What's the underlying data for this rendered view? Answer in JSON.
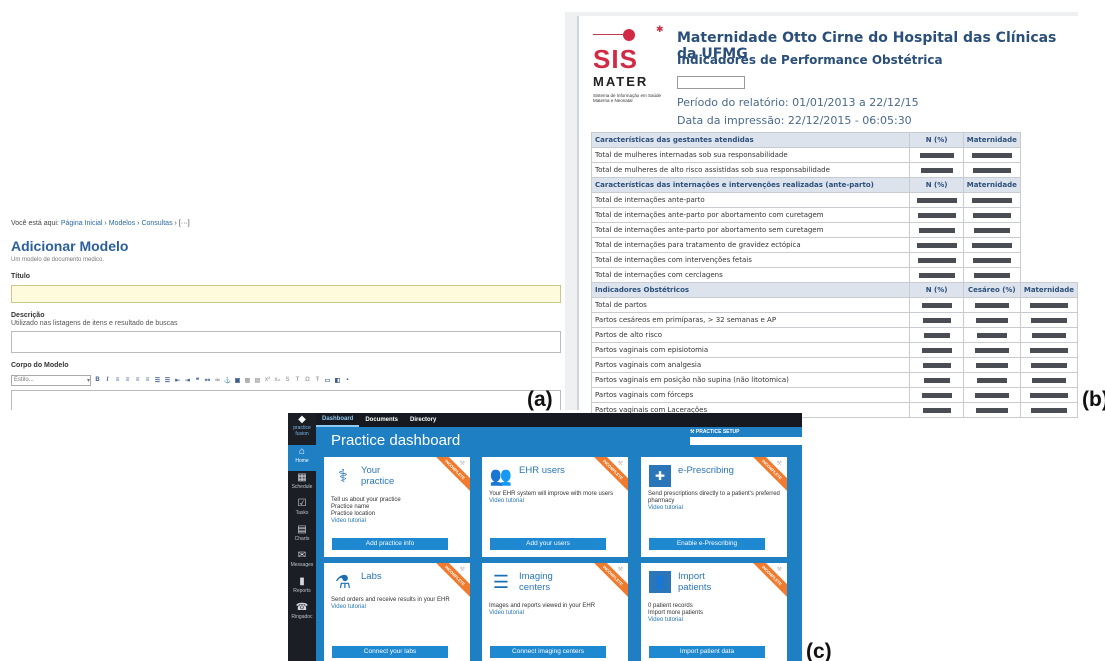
{
  "labels": {
    "a": "(a)",
    "b": "(b)",
    "c": "(c)"
  },
  "panel_a": {
    "breadcrumb_prefix": "Você está aqui:",
    "breadcrumb_items": [
      "Página Inicial",
      "›",
      "Modelos",
      "›",
      "Consultas",
      "›",
      "[···]"
    ],
    "heading": "Adicionar Modelo",
    "subheading": "Um modelo de documento medico.",
    "title_label": "Título",
    "description_label": "Descrição",
    "description_hint": "Utilizado nas listagens de itens e resultado de buscas",
    "body_label": "Corpo do Modelo",
    "style_select": "Estilo..."
  },
  "panel_b": {
    "logo_sis": "SIS",
    "logo_mater": "MATER",
    "logo_subtitle": "Sistema de Informação em Saúde Materna e Neonatal",
    "title": "Maternidade Otto Cirne do Hospital das Clínicas da UFMG",
    "subtitle": "Indicadores de Performance Obstétrica",
    "period": "Período do relatório: 01/01/2013 a 22/12/15",
    "print_date": "Data da impressão: 22/12/2015 - 06:05:30",
    "sections": [
      {
        "header": [
          "Características das gestantes atendidas",
          "N (%)",
          "Maternidade"
        ],
        "rows": [
          "Total de mulheres internadas sob sua responsabilidade",
          "Total de mulheres de alto risco assistidas sob sua responsabilidade"
        ]
      },
      {
        "header": [
          "Características das internações e intervenções realizadas (ante-parto)",
          "N (%)",
          "Maternidade"
        ],
        "rows": [
          "Total de internações ante-parto",
          "Total de internações ante-parto por abortamento com curetagem",
          "Total de internações ante-parto por abortamento sem curetagem",
          "Total de internações para tratamento de gravidez ectópica",
          "Total de internações com intervenções fetais",
          "Total de internações com cerclagens"
        ]
      },
      {
        "header": [
          "Indicadores Obstétricos",
          "N (%)",
          "Cesáreo (%)",
          "Maternidade"
        ],
        "rows": [
          "Total de partos",
          "Partos cesáreos em primíparas, > 32 semanas e AP",
          "Partos de alto risco",
          "Partos vaginais com episiotomia",
          "Partos vaginais com analgesia",
          "Partos vaginais em posição não supina (não litotomica)",
          "Partos vaginais com fórceps",
          "Partos vaginais com Lacerações"
        ]
      }
    ]
  },
  "panel_c": {
    "brand": [
      "practice",
      "fusion"
    ],
    "nav": [
      {
        "label": "Home",
        "icon": "⌂"
      },
      {
        "label": "Schedule",
        "icon": "▦"
      },
      {
        "label": "Tasks",
        "icon": "☑"
      },
      {
        "label": "Charts",
        "icon": "▤"
      },
      {
        "label": "Messages",
        "icon": "✉"
      },
      {
        "label": "Reports",
        "icon": "▮"
      },
      {
        "label": "Ringadoc",
        "icon": "☎"
      }
    ],
    "tabs": [
      "Dashboard",
      "Documents",
      "Directory"
    ],
    "page_title": "Practice dashboard",
    "setup_label": "PRACTICE SETUP",
    "ribbon": "INCOMPLETE",
    "video_tutorial": "Video tutorial",
    "cards": [
      {
        "title": "Your practice",
        "desc": [
          "Tell us about your practice",
          "Practice name",
          "Practice location"
        ],
        "button": "Add practice info"
      },
      {
        "title": "EHR users",
        "desc": [
          "Your EHR system will improve with more users"
        ],
        "button": "Add your users"
      },
      {
        "title": "e-Prescribing",
        "desc": [
          "Send prescriptions directly to a patient's preferred pharmacy"
        ],
        "button": "Enable e-Prescribing"
      },
      {
        "title": "Labs",
        "desc": [
          "Send orders and receive results in your EHR"
        ],
        "button": "Connect your labs"
      },
      {
        "title": "Imaging centers",
        "desc": [
          "Images and reports viewed in your EHR"
        ],
        "button": "Connect imaging centers"
      },
      {
        "title": "Import patients",
        "desc": [
          "0 patient records",
          "Import more patients"
        ],
        "button": "Import patient data"
      }
    ]
  }
}
